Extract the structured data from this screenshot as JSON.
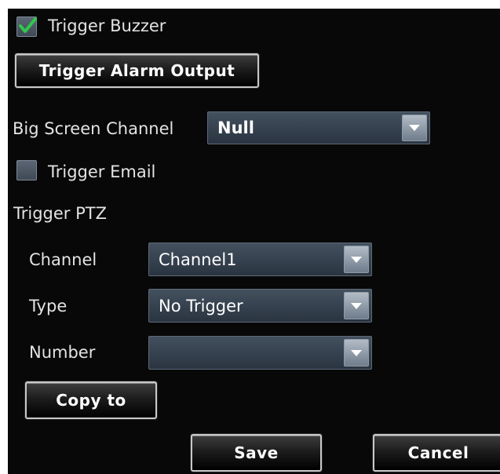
{
  "trigger_buzzer": {
    "label": "Trigger Buzzer",
    "checked": true
  },
  "trigger_alarm_output": {
    "label": "Trigger Alarm Output"
  },
  "big_screen_channel": {
    "label": "Big Screen Channel",
    "value": "Null"
  },
  "trigger_email": {
    "label": "Trigger Email",
    "checked": false
  },
  "trigger_ptz": {
    "label": "Trigger PTZ",
    "channel": {
      "label": "Channel",
      "value": "Channel1"
    },
    "type": {
      "label": "Type",
      "value": "No Trigger"
    },
    "number": {
      "label": "Number",
      "value": ""
    }
  },
  "buttons": {
    "copy_to": "Copy to",
    "save": "Save",
    "cancel": "Cancel"
  },
  "colors": {
    "background": "#080808",
    "checkbox_tick": "#2fc84a",
    "select_bg": "#2f3a47",
    "text": "#e3e3e3"
  },
  "icons": {
    "checkbox_tick": "check-icon",
    "dropdown": "chevron-down-icon"
  }
}
